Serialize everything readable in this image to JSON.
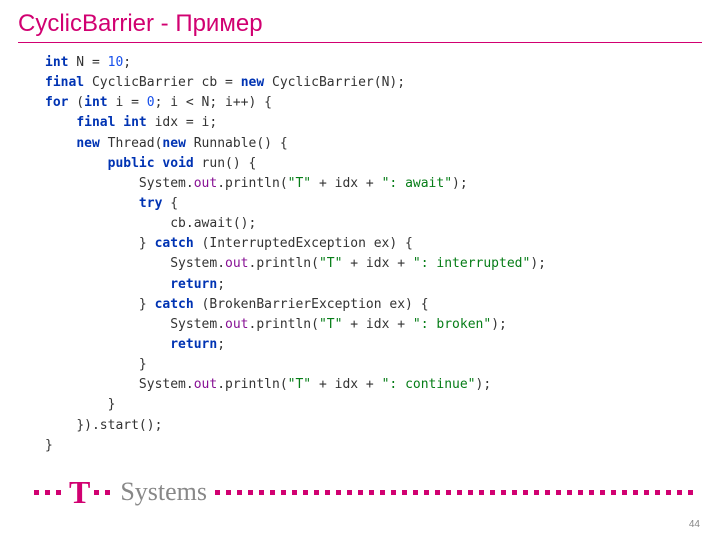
{
  "title": "CyclicBarrier - Пример",
  "page_number": "44",
  "logo": {
    "t": "T",
    "systems": "Systems"
  },
  "code": {
    "l1": {
      "kw1": "int",
      "p1": " N = ",
      "n1": "10",
      "p2": ";"
    },
    "l2": {
      "kw1": "final",
      "p1": " CyclicBarrier cb = ",
      "kw2": "new",
      "p2": " CyclicBarrier(N);"
    },
    "l3": {
      "kw1": "for",
      "p1": " (",
      "kw2": "int",
      "p2": " i = ",
      "n1": "0",
      "p3": "; i < N; i++) {"
    },
    "l4": {
      "kw1": "final int",
      "p1": " idx = i;"
    },
    "l5": {
      "kw1": "new",
      "p1": " Thread(",
      "kw2": "new",
      "p2": " Runnable() {"
    },
    "l6": {
      "kw1": "public void",
      "p1": " run() {"
    },
    "l7": {
      "p1": "System.",
      "f1": "out",
      "p2": ".println(",
      "s1": "\"T\"",
      "p3": " + idx + ",
      "s2": "\": await\"",
      "p4": ");"
    },
    "l8": {
      "kw1": "try",
      "p1": " {"
    },
    "l9": {
      "p1": "cb.await();"
    },
    "l10": {
      "p1": "} ",
      "kw1": "catch",
      "p2": " (InterruptedException ex) {"
    },
    "l11": {
      "p1": "System.",
      "f1": "out",
      "p2": ".println(",
      "s1": "\"T\"",
      "p3": " + idx + ",
      "s2": "\": interrupted\"",
      "p4": ");"
    },
    "l12": {
      "kw1": "return",
      "p1": ";"
    },
    "l13": {
      "p1": "} ",
      "kw1": "catch",
      "p2": " (BrokenBarrierException ex) {"
    },
    "l14": {
      "p1": "System.",
      "f1": "out",
      "p2": ".println(",
      "s1": "\"T\"",
      "p3": " + idx + ",
      "s2": "\": broken\"",
      "p4": ");"
    },
    "l15": {
      "kw1": "return",
      "p1": ";"
    },
    "l16": {
      "p1": "}"
    },
    "l17": {
      "p1": "System.",
      "f1": "out",
      "p2": ".println(",
      "s1": "\"T\"",
      "p3": " + idx + ",
      "s2": "\": continue\"",
      "p4": ");"
    },
    "l18": {
      "p1": "}"
    },
    "l19": {
      "p1": "}).start();"
    },
    "l20": {
      "p1": "}"
    }
  }
}
